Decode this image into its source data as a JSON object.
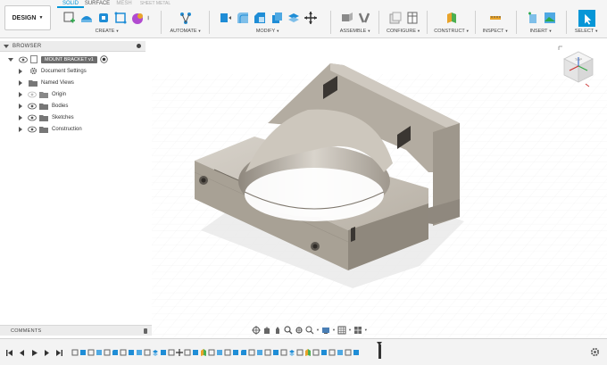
{
  "workspace": {
    "label": "DESIGN"
  },
  "tabs": [
    "SOLID",
    "SURFACE",
    "MESH",
    "SHEET METAL"
  ],
  "active_tab": "SOLID",
  "toolbar_groups": [
    {
      "id": "create",
      "label": "CREATE"
    },
    {
      "id": "automate",
      "label": "AUTOMATE"
    },
    {
      "id": "modify",
      "label": "MODIFY"
    },
    {
      "id": "assemble",
      "label": "ASSEMBLE"
    },
    {
      "id": "configure",
      "label": "CONFIGURE"
    },
    {
      "id": "construct",
      "label": "CONSTRUCT"
    },
    {
      "id": "inspect",
      "label": "INSPECT"
    },
    {
      "id": "insert",
      "label": "INSERT"
    },
    {
      "id": "select",
      "label": "SELECT"
    }
  ],
  "browser": {
    "title": "BROWSER",
    "root": "MOUNT BRACKET v1",
    "items": [
      {
        "label": "Document Settings",
        "icon": "gear-icon"
      },
      {
        "label": "Named Views",
        "icon": "folder-icon"
      },
      {
        "label": "Origin",
        "icon": "folder-icon"
      },
      {
        "label": "Bodies",
        "icon": "folder-icon"
      },
      {
        "label": "Sketches",
        "icon": "folder-icon"
      },
      {
        "label": "Construction",
        "icon": "folder-icon"
      }
    ]
  },
  "comments": {
    "title": "COMMENTS"
  },
  "viewcube": {
    "face": "TOP"
  },
  "colors": {
    "accent": "#0696d7",
    "model": "#b9b2a7",
    "toolbar_bg": "#f5f5f5"
  }
}
